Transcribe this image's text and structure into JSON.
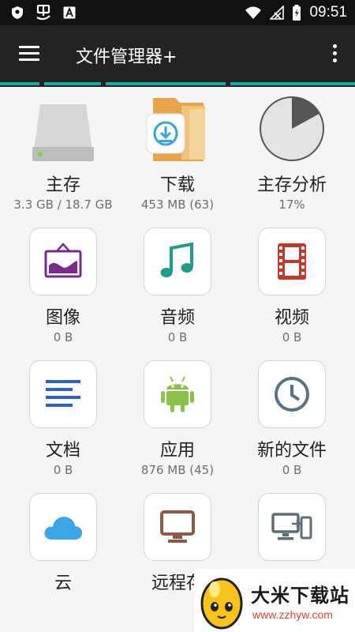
{
  "status_bar": {
    "time": "09:51",
    "icons": [
      "shield-icon",
      "app-glyph-icon",
      "font-a-icon",
      "wifi-icon",
      "signal-icon",
      "battery-icon"
    ]
  },
  "app_bar": {
    "title": "文件管理器+",
    "menu_icon": "hamburger-menu-icon",
    "overflow_icon": "more-vert-icon"
  },
  "colors": {
    "appbar": "#232323",
    "accent": "#19a9a0",
    "image_icon": "#7a2a8c",
    "audio_icon": "#1f9d8a",
    "video_icon": "#c0392b",
    "document_icon": "#2d62c8",
    "app_icon": "#8bc34a",
    "recent_icon": "#5a7384",
    "cloud_icon": "#3da5ea",
    "remote_icon": "#8d5a48",
    "network_icon": "#5d6d74"
  },
  "grid": {
    "items": [
      {
        "label": "主存",
        "sub": "3.3 GB / 18.7 GB",
        "icon": "storage-drive-icon"
      },
      {
        "label": "下载",
        "sub": "453 MB (63)",
        "icon": "download-folder-icon"
      },
      {
        "label": "主存分析",
        "sub": "17%",
        "icon": "pie-chart-icon",
        "used_fraction": 0.17
      },
      {
        "label": "图像",
        "sub": "0 B",
        "icon": "image-icon"
      },
      {
        "label": "音频",
        "sub": "0 B",
        "icon": "music-note-icon"
      },
      {
        "label": "视频",
        "sub": "0 B",
        "icon": "film-icon"
      },
      {
        "label": "文档",
        "sub": "0 B",
        "icon": "document-icon"
      },
      {
        "label": "应用",
        "sub": "876 MB (45)",
        "icon": "android-icon"
      },
      {
        "label": "新的文件",
        "sub": "0 B",
        "icon": "clock-icon"
      },
      {
        "label": "云",
        "sub": "",
        "icon": "cloud-icon"
      },
      {
        "label": "远程存",
        "sub": "",
        "icon": "monitor-icon"
      },
      {
        "label": "",
        "sub": "",
        "icon": "devices-icon"
      }
    ]
  },
  "watermark": {
    "title": "大米下载站",
    "url": "www.zzhyw.com"
  }
}
